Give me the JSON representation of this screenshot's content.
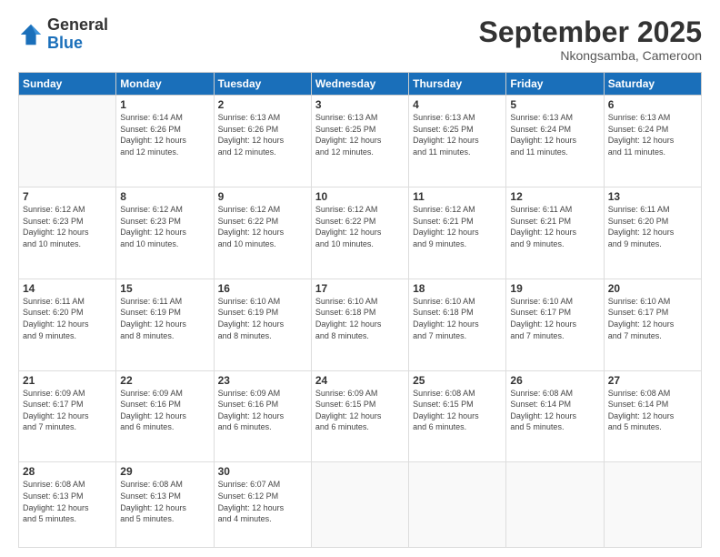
{
  "logo": {
    "general": "General",
    "blue": "Blue"
  },
  "title": "September 2025",
  "subtitle": "Nkongsamba, Cameroon",
  "days_of_week": [
    "Sunday",
    "Monday",
    "Tuesday",
    "Wednesday",
    "Thursday",
    "Friday",
    "Saturday"
  ],
  "weeks": [
    [
      {
        "day": "",
        "info": ""
      },
      {
        "day": "1",
        "info": "Sunrise: 6:14 AM\nSunset: 6:26 PM\nDaylight: 12 hours\nand 12 minutes."
      },
      {
        "day": "2",
        "info": "Sunrise: 6:13 AM\nSunset: 6:26 PM\nDaylight: 12 hours\nand 12 minutes."
      },
      {
        "day": "3",
        "info": "Sunrise: 6:13 AM\nSunset: 6:25 PM\nDaylight: 12 hours\nand 12 minutes."
      },
      {
        "day": "4",
        "info": "Sunrise: 6:13 AM\nSunset: 6:25 PM\nDaylight: 12 hours\nand 11 minutes."
      },
      {
        "day": "5",
        "info": "Sunrise: 6:13 AM\nSunset: 6:24 PM\nDaylight: 12 hours\nand 11 minutes."
      },
      {
        "day": "6",
        "info": "Sunrise: 6:13 AM\nSunset: 6:24 PM\nDaylight: 12 hours\nand 11 minutes."
      }
    ],
    [
      {
        "day": "7",
        "info": "Sunrise: 6:12 AM\nSunset: 6:23 PM\nDaylight: 12 hours\nand 10 minutes."
      },
      {
        "day": "8",
        "info": "Sunrise: 6:12 AM\nSunset: 6:23 PM\nDaylight: 12 hours\nand 10 minutes."
      },
      {
        "day": "9",
        "info": "Sunrise: 6:12 AM\nSunset: 6:22 PM\nDaylight: 12 hours\nand 10 minutes."
      },
      {
        "day": "10",
        "info": "Sunrise: 6:12 AM\nSunset: 6:22 PM\nDaylight: 12 hours\nand 10 minutes."
      },
      {
        "day": "11",
        "info": "Sunrise: 6:12 AM\nSunset: 6:21 PM\nDaylight: 12 hours\nand 9 minutes."
      },
      {
        "day": "12",
        "info": "Sunrise: 6:11 AM\nSunset: 6:21 PM\nDaylight: 12 hours\nand 9 minutes."
      },
      {
        "day": "13",
        "info": "Sunrise: 6:11 AM\nSunset: 6:20 PM\nDaylight: 12 hours\nand 9 minutes."
      }
    ],
    [
      {
        "day": "14",
        "info": "Sunrise: 6:11 AM\nSunset: 6:20 PM\nDaylight: 12 hours\nand 9 minutes."
      },
      {
        "day": "15",
        "info": "Sunrise: 6:11 AM\nSunset: 6:19 PM\nDaylight: 12 hours\nand 8 minutes."
      },
      {
        "day": "16",
        "info": "Sunrise: 6:10 AM\nSunset: 6:19 PM\nDaylight: 12 hours\nand 8 minutes."
      },
      {
        "day": "17",
        "info": "Sunrise: 6:10 AM\nSunset: 6:18 PM\nDaylight: 12 hours\nand 8 minutes."
      },
      {
        "day": "18",
        "info": "Sunrise: 6:10 AM\nSunset: 6:18 PM\nDaylight: 12 hours\nand 7 minutes."
      },
      {
        "day": "19",
        "info": "Sunrise: 6:10 AM\nSunset: 6:17 PM\nDaylight: 12 hours\nand 7 minutes."
      },
      {
        "day": "20",
        "info": "Sunrise: 6:10 AM\nSunset: 6:17 PM\nDaylight: 12 hours\nand 7 minutes."
      }
    ],
    [
      {
        "day": "21",
        "info": "Sunrise: 6:09 AM\nSunset: 6:17 PM\nDaylight: 12 hours\nand 7 minutes."
      },
      {
        "day": "22",
        "info": "Sunrise: 6:09 AM\nSunset: 6:16 PM\nDaylight: 12 hours\nand 6 minutes."
      },
      {
        "day": "23",
        "info": "Sunrise: 6:09 AM\nSunset: 6:16 PM\nDaylight: 12 hours\nand 6 minutes."
      },
      {
        "day": "24",
        "info": "Sunrise: 6:09 AM\nSunset: 6:15 PM\nDaylight: 12 hours\nand 6 minutes."
      },
      {
        "day": "25",
        "info": "Sunrise: 6:08 AM\nSunset: 6:15 PM\nDaylight: 12 hours\nand 6 minutes."
      },
      {
        "day": "26",
        "info": "Sunrise: 6:08 AM\nSunset: 6:14 PM\nDaylight: 12 hours\nand 5 minutes."
      },
      {
        "day": "27",
        "info": "Sunrise: 6:08 AM\nSunset: 6:14 PM\nDaylight: 12 hours\nand 5 minutes."
      }
    ],
    [
      {
        "day": "28",
        "info": "Sunrise: 6:08 AM\nSunset: 6:13 PM\nDaylight: 12 hours\nand 5 minutes."
      },
      {
        "day": "29",
        "info": "Sunrise: 6:08 AM\nSunset: 6:13 PM\nDaylight: 12 hours\nand 5 minutes."
      },
      {
        "day": "30",
        "info": "Sunrise: 6:07 AM\nSunset: 6:12 PM\nDaylight: 12 hours\nand 4 minutes."
      },
      {
        "day": "",
        "info": ""
      },
      {
        "day": "",
        "info": ""
      },
      {
        "day": "",
        "info": ""
      },
      {
        "day": "",
        "info": ""
      }
    ]
  ]
}
